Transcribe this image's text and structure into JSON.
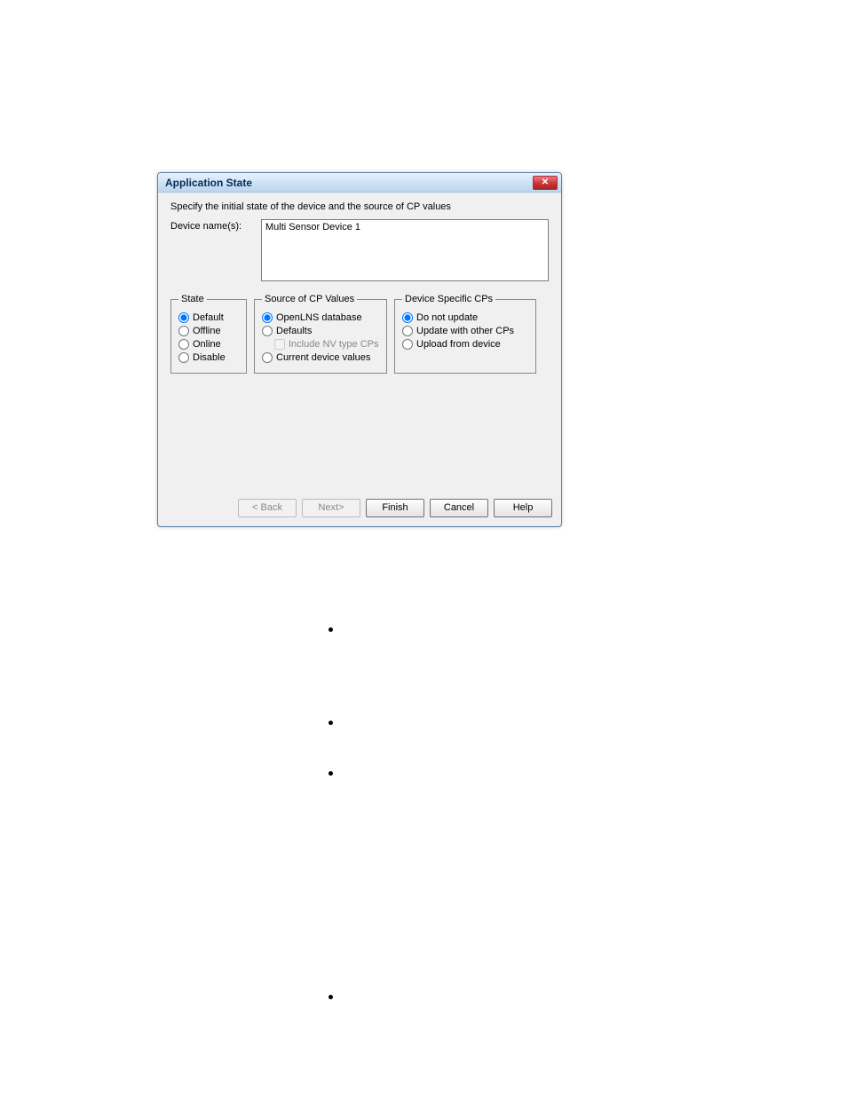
{
  "dialog": {
    "title": "Application State",
    "instruction": "Specify the initial state of the device and the source of CP values",
    "device_names_label": "Device name(s):",
    "device_names_value": "Multi Sensor Device 1",
    "groups": {
      "state": {
        "legend": "State",
        "options": {
          "default": "Default",
          "offline": "Offline",
          "online": "Online",
          "disable": "Disable"
        },
        "selected": "default"
      },
      "source": {
        "legend": "Source of CP Values",
        "options": {
          "openlns": "OpenLNS database",
          "defaults": "Defaults",
          "include_nv": "Include NV type CPs",
          "current": "Current device values"
        },
        "selected": "openlns",
        "include_nv_checked": false
      },
      "specific": {
        "legend": "Device Specific CPs",
        "options": {
          "do_not_update": "Do not update",
          "update_with_other": "Update with other CPs",
          "upload": "Upload from device"
        },
        "selected": "do_not_update"
      }
    },
    "buttons": {
      "back": "< Back",
      "next": "Next>",
      "finish": "Finish",
      "cancel": "Cancel",
      "help": "Help"
    }
  },
  "page_bullets": [
    707,
    812,
    869,
    1121
  ]
}
